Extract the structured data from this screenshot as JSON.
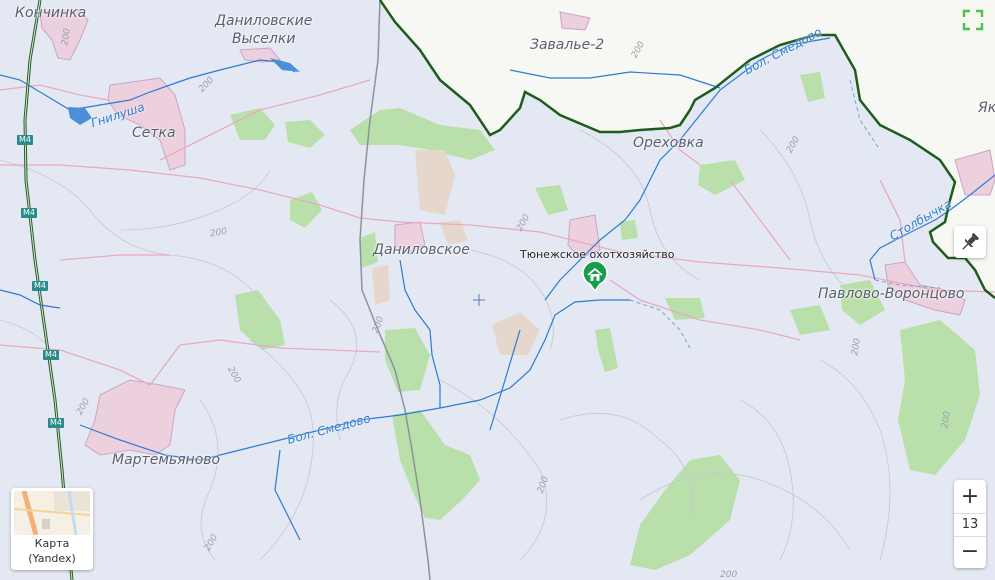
{
  "map": {
    "settlements": [
      {
        "id": "konchinka",
        "name": "Кончинка"
      },
      {
        "id": "danilovskie-vyselki",
        "name": "Даниловские\nВыселки"
      },
      {
        "id": "setka",
        "name": "Сетка"
      },
      {
        "id": "zavalye-2",
        "name": "Завалье-2"
      },
      {
        "id": "orekhovka",
        "name": "Ореховка"
      },
      {
        "id": "danilovskoe",
        "name": "Даниловское"
      },
      {
        "id": "pavlovo-vorontsovo",
        "name": "Павлово-Воронцово"
      },
      {
        "id": "martemyanovo",
        "name": "Мартемьяново"
      },
      {
        "id": "ya-partial",
        "name": "Як"
      }
    ],
    "rivers": [
      {
        "id": "gnilusha",
        "name": "Гнилуша"
      },
      {
        "id": "bol-smedovo-1",
        "name": "Бол. Смедово"
      },
      {
        "id": "bol-smedovo-2",
        "name": "Бол. Смедово"
      },
      {
        "id": "stolbychka",
        "name": "Столбычка"
      }
    ],
    "highway_label": "М4",
    "contour_label": "200",
    "poi": {
      "name": "Тюнежское охотхозяйство",
      "icon": "house-icon",
      "color": "#1a9c4a"
    },
    "colors": {
      "background": "#e4e8f2",
      "forest": "#b5e0a8",
      "settlement": "#eacbdc",
      "road": "#e9a9c0",
      "water": "#2e7bd1",
      "border": "#1e5c1e",
      "highway": "#2b5b2b"
    }
  },
  "controls": {
    "zoom_in_label": "+",
    "zoom_out_label": "−",
    "zoom_level": "13",
    "layer_label_line1": "Карта",
    "layer_label_line2": "(Yandex)"
  }
}
